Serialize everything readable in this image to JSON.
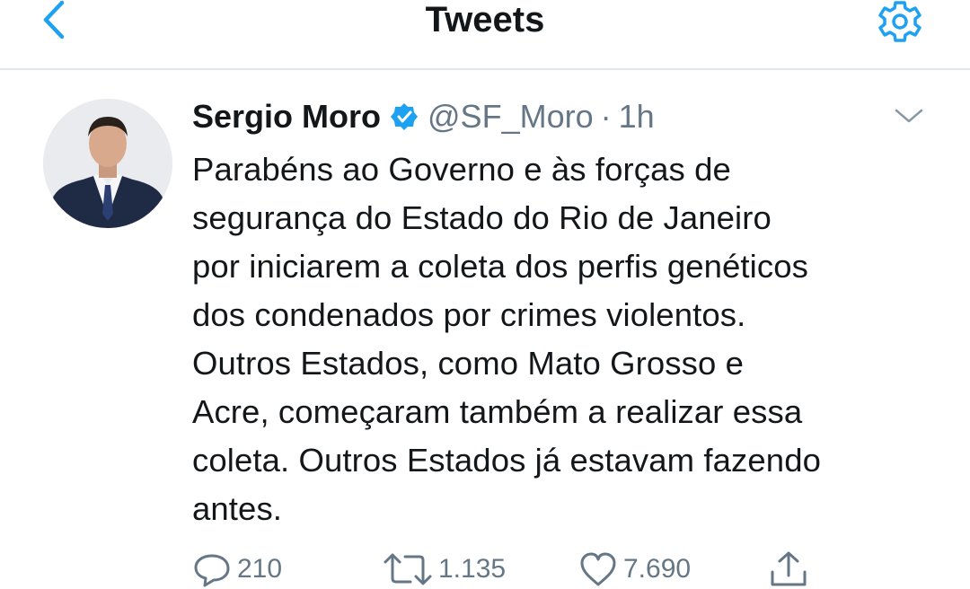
{
  "nav": {
    "title": "Tweets",
    "back_icon": "chevron-left-icon",
    "settings_icon": "gear-icon"
  },
  "tweet": {
    "author": {
      "name": "Sergio Moro",
      "verified_icon": "verified-badge-icon",
      "handle": "@SF_Moro",
      "separator": "·",
      "time": "1h"
    },
    "menu_icon": "chevron-down-icon",
    "text": "Parabéns ao Governo e às forças de\nsegurança do Estado do Rio de Janeiro\npor iniciarem a coleta dos perfis genéticos\ndos condenados por crimes violentos.\nOutros Estados, como Mato Grosso e\nAcre, começaram também a realizar essa\ncoleta. Outros Estados já estavam fazendo\nantes.",
    "actions": {
      "reply_count": "210",
      "retweet_count": "1.135",
      "like_count": "7.690",
      "reply_icon": "reply-icon",
      "retweet_icon": "retweet-icon",
      "like_icon": "heart-icon",
      "share_icon": "share-icon"
    }
  },
  "colors": {
    "accent": "#1da1f2",
    "text": "#14171a",
    "secondary": "#657786",
    "divider": "#e1e8ed"
  }
}
